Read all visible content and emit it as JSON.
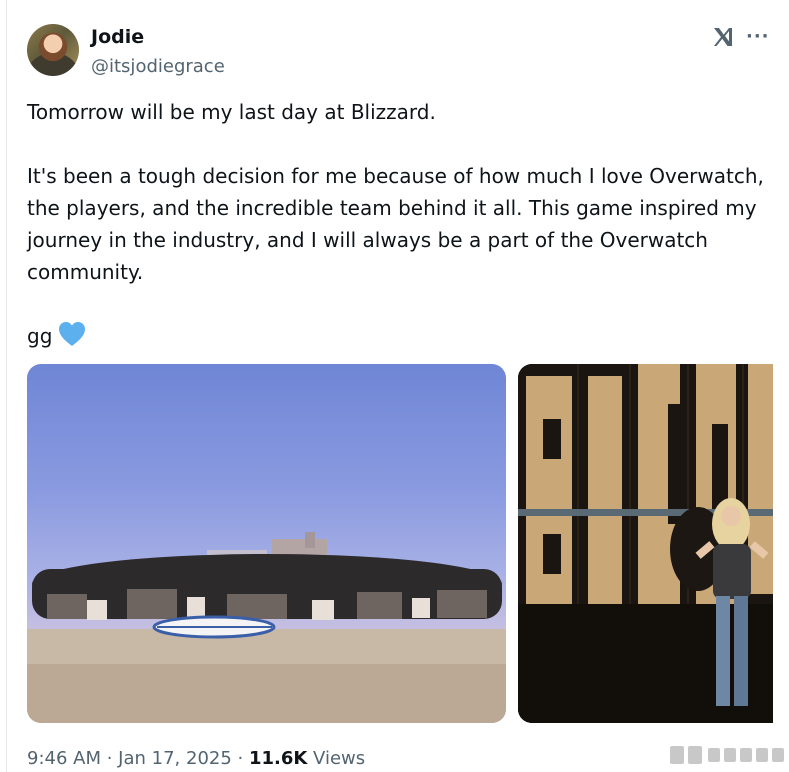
{
  "author": {
    "display_name": "Jodie",
    "handle": "@itsjodiegrace"
  },
  "header_icons": {
    "logo": "x-logo-icon",
    "more": "more-options-icon",
    "more_glyph": "···"
  },
  "tweet": {
    "line1": "Tomorrow will be my last day at Blizzard.",
    "paragraph2": "It's been a tough decision for me because of how much I love Overwatch, the players, and the incredible team behind it all. This game inspired my journey in the industry, and I will always be a part of the Overwatch community.",
    "line3": "gg",
    "emoji": "blue-heart-icon"
  },
  "media": [
    {
      "name": "team-group-photo",
      "description_icon": "beach-group-photo"
    },
    {
      "name": "blizzard-sign-photo",
      "description_icon": "sign-wall-photo"
    }
  ],
  "meta": {
    "time": "9:46 AM",
    "separator1": " · ",
    "date": "Jan 17, 2025",
    "separator2": " · ",
    "views_count": "11.6K",
    "views_label": " Views"
  },
  "colors": {
    "text_primary": "#0f1419",
    "text_secondary": "#536471",
    "heart": "#5db0ee"
  }
}
